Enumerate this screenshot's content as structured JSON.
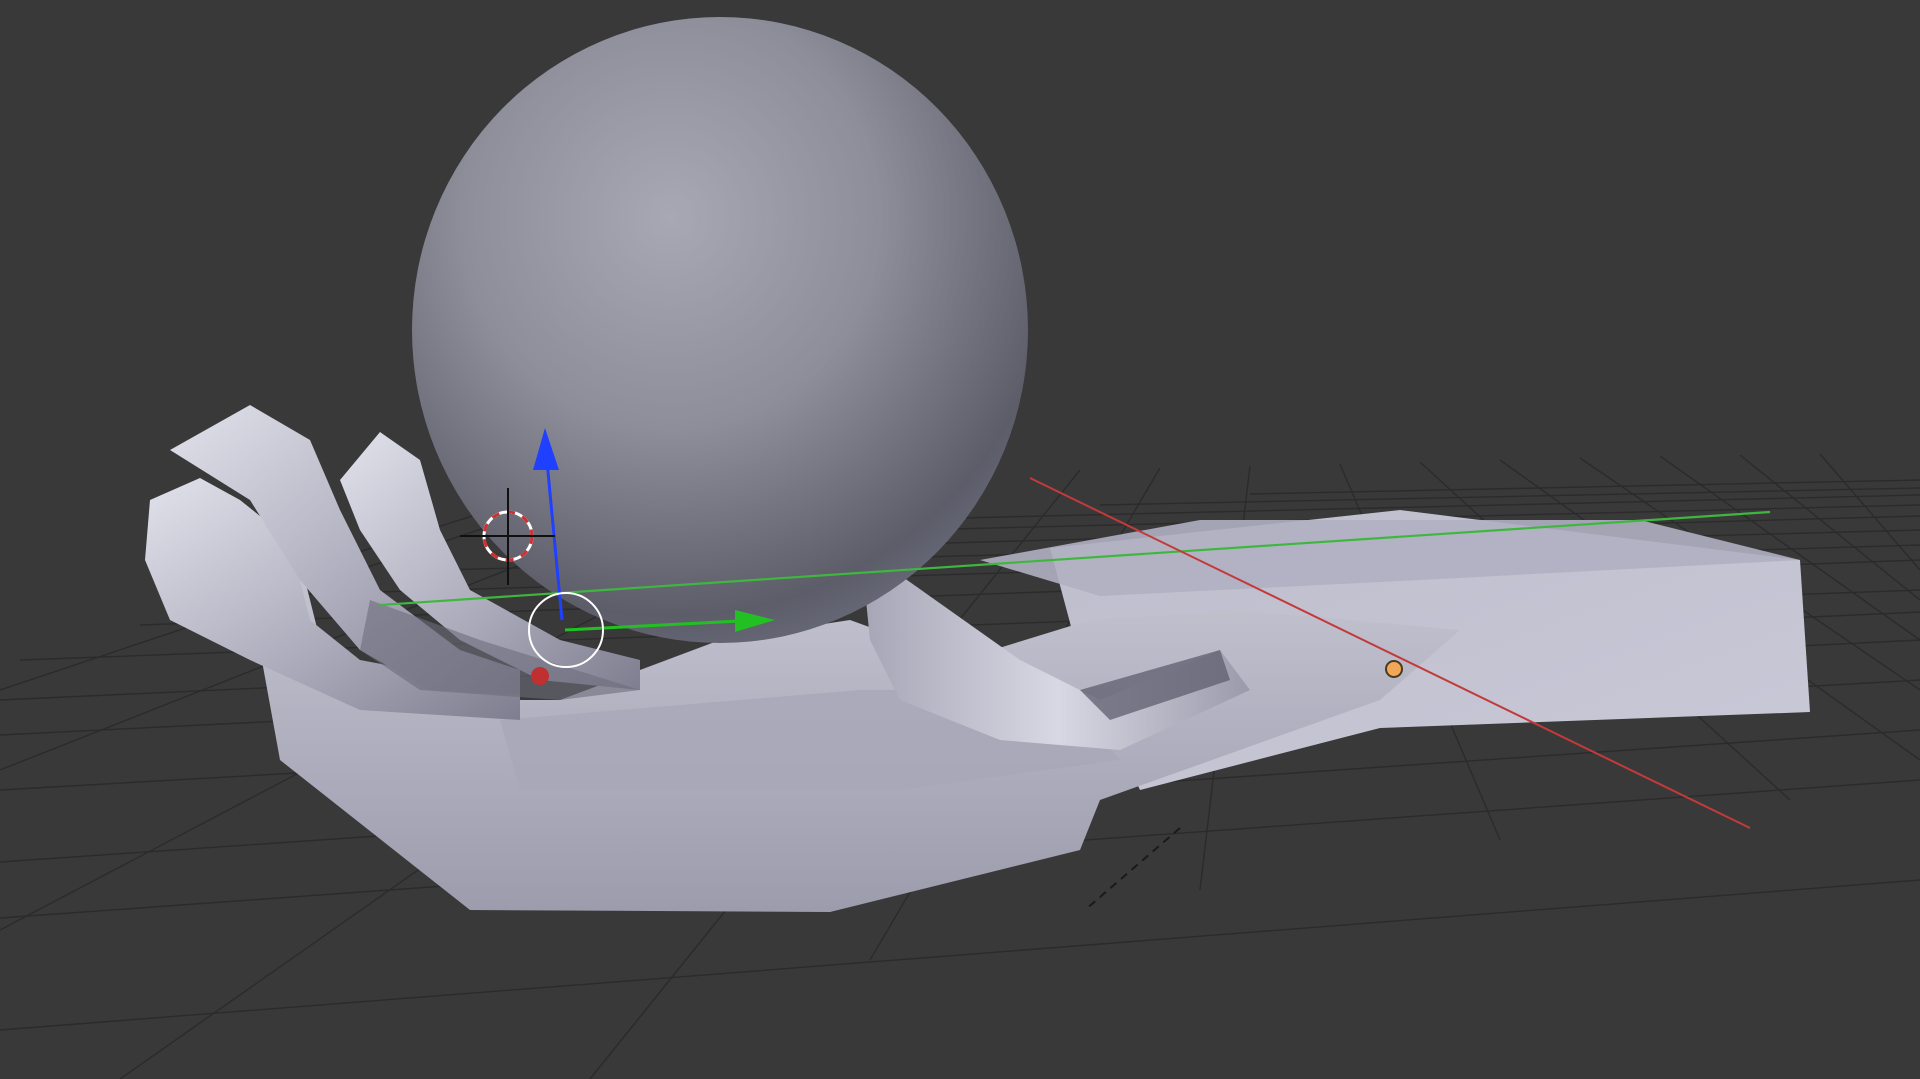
{
  "app": "Blender",
  "viewport": {
    "background": "#393939",
    "shading": "solid",
    "grid_color": "#2a2a2a",
    "x_axis_color": "#c33a3a",
    "y_axis_color": "#3fb73f",
    "objects": [
      {
        "name": "sphere",
        "color": "#8a8b98"
      },
      {
        "name": "hand",
        "color": "#b9b9c8",
        "selected": true
      }
    ],
    "widgets": {
      "cursor_3d": "3d-cursor-icon",
      "manipulator": "translate-manipulator-icon",
      "manipulator_colors": {
        "x": "#c03030",
        "y": "#22c022",
        "z": "#2040ff"
      },
      "object_origin_color": "#f0a858"
    }
  }
}
